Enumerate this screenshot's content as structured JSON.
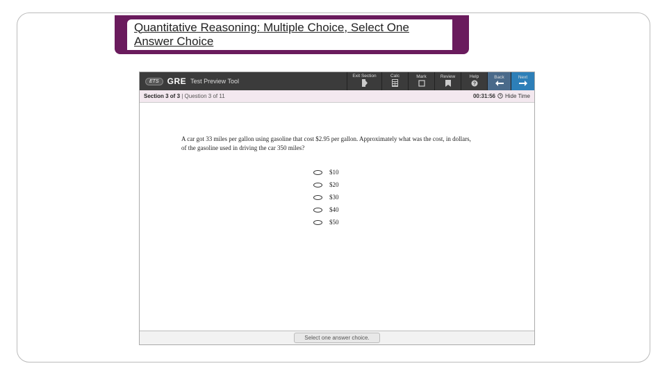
{
  "slide": {
    "title": "Quantitative Reasoning: Multiple Choice, Select One Answer Choice"
  },
  "app": {
    "brand_ets": "ETS",
    "brand_gre": "GRE",
    "tool_name": "Test Preview Tool",
    "toolbar": {
      "exit": "Exit Section",
      "calc": "Calc",
      "mark": "Mark",
      "review": "Review",
      "help": "Help",
      "back": "Back",
      "next": "Next"
    },
    "section_bar": {
      "section": "Section 3 of 3",
      "sep": " | ",
      "question": "Question 3 of 11",
      "timer": "00:31:56",
      "hide_time": "Hide Time"
    },
    "question": "A car got 33 miles per gallon using gasoline that cost $2.95 per gallon. Approximately what was the cost, in dollars, of the gasoline used in driving the car 350 miles?",
    "choices": [
      "$10",
      "$20",
      "$30",
      "$40",
      "$50"
    ],
    "footer": "Select one answer choice."
  }
}
